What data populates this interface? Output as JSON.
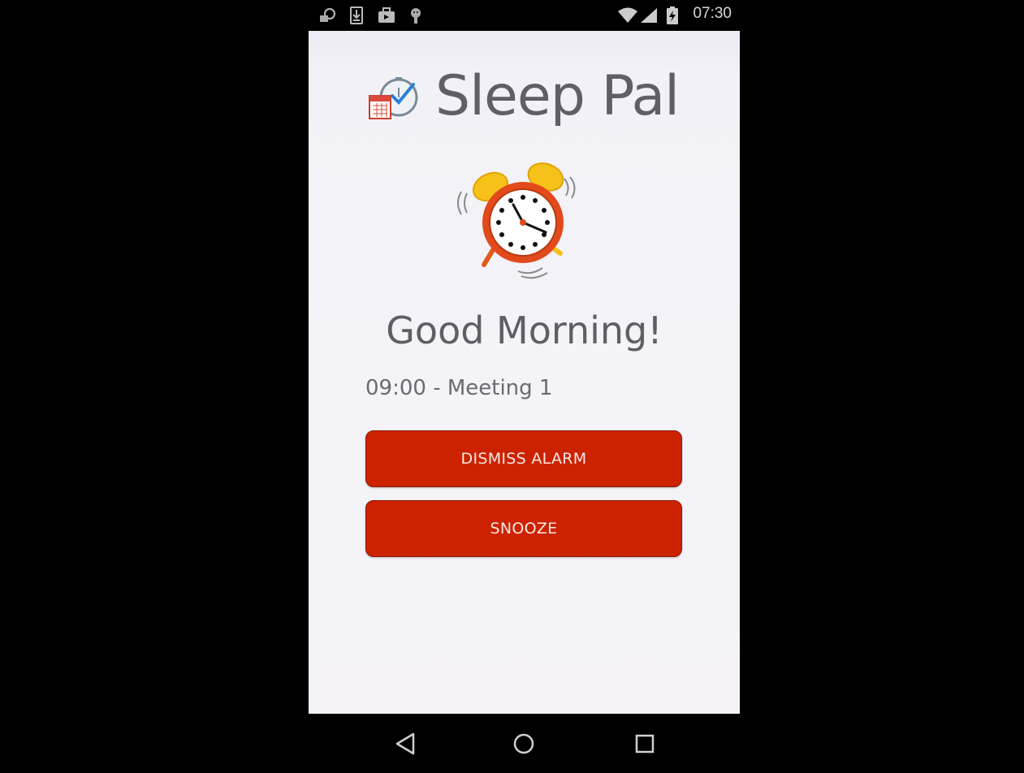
{
  "status_bar": {
    "time": "07:30",
    "left_icons": [
      "clock-calendar-notification-icon",
      "download-icon",
      "briefcase-icon",
      "android-icon"
    ],
    "right_icons": [
      "wifi-icon",
      "cellular-signal-icon",
      "battery-charging-icon"
    ]
  },
  "app": {
    "title": "Sleep Pal",
    "logo_icon": "clock-calendar-logo-icon"
  },
  "main": {
    "alarm_icon": "ringing-alarm-clock-icon",
    "greeting": "Good Morning!",
    "event": "09:00 - Meeting 1",
    "dismiss_label": "DISMISS ALARM",
    "snooze_label": "SNOOZE"
  },
  "nav_bar": {
    "buttons": [
      "back-icon",
      "home-icon",
      "recents-icon"
    ]
  },
  "colors": {
    "button_bg": "#cc2200",
    "button_text": "#fbe8e4",
    "screen_bg": "#f3f3f8",
    "title_text": "#5f5f66"
  }
}
